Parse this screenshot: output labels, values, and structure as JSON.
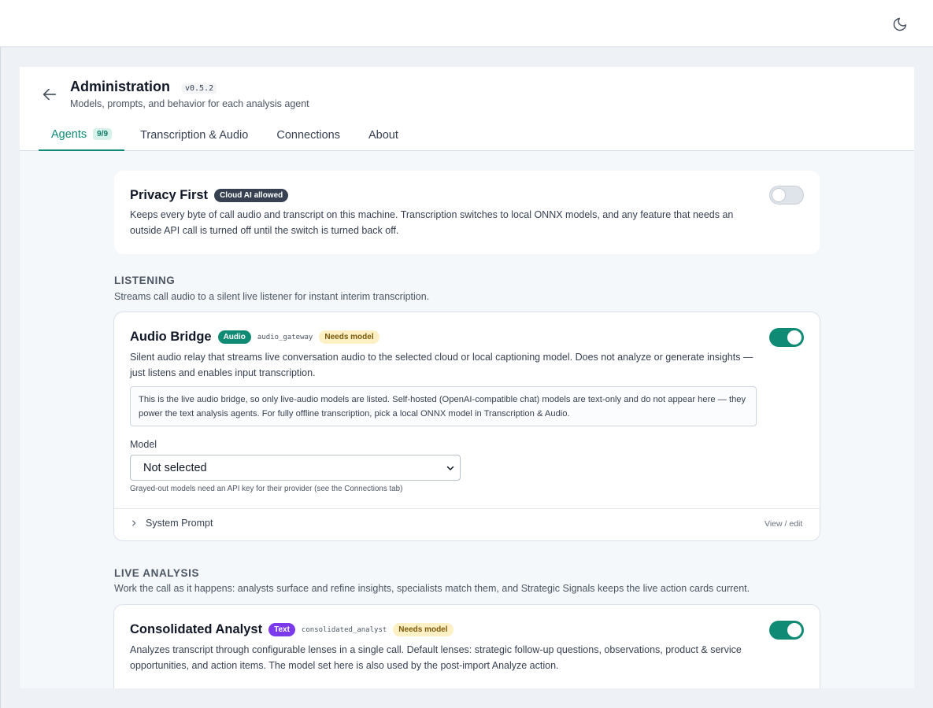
{
  "topbar": {
    "theme_icon": "moon-icon"
  },
  "header": {
    "title": "Administration",
    "version": "v0.5.2",
    "subtitle": "Models, prompts, and behavior for each analysis agent"
  },
  "tabs": [
    {
      "label": "Agents",
      "count": "9/9",
      "active": true
    },
    {
      "label": "Transcription & Audio"
    },
    {
      "label": "Connections"
    },
    {
      "label": "About"
    }
  ],
  "privacy": {
    "title": "Privacy First",
    "badge": "Cloud AI allowed",
    "description": "Keeps every byte of call audio and transcript on this machine. Transcription switches to local ONNX models, and any feature that needs an outside API call is turned off until the switch is turned back off.",
    "enabled": false
  },
  "sections": {
    "listening": {
      "label": "LISTENING",
      "description": "Streams call audio to a silent live listener for instant interim transcription."
    },
    "live_analysis": {
      "label": "LIVE ANALYSIS",
      "description": "Work the call as it happens: analysts surface and refine insights, specialists match them, and Strategic Signals keeps the live action cards current."
    }
  },
  "agents": {
    "audio_bridge": {
      "title": "Audio Bridge",
      "type_badge": "Audio",
      "id": "audio_gateway",
      "status_badge": "Needs model",
      "description": "Silent audio relay that streams live conversation audio to the selected cloud or local captioning model. Does not analyze or generate insights — just listens and enables input transcription.",
      "note": "This is the live audio bridge, so only live-audio models are listed. Self-hosted (OpenAI-compatible chat) models are text-only and do not appear here — they power the text analysis agents. For fully offline transcription, pick a local ONNX model in Transcription & Audio.",
      "model_label": "Model",
      "model_value": "Not selected",
      "model_hint": "Grayed-out models need an API key for their provider (see the Connections tab)",
      "system_prompt_label": "System Prompt",
      "view_edit": "View / edit",
      "enabled": true
    },
    "consolidated_analyst": {
      "title": "Consolidated Analyst",
      "type_badge": "Text",
      "id": "consolidated_analyst",
      "status_badge": "Needs model",
      "description": "Analyzes transcript through configurable lenses in a single call. Default lenses: strategic follow-up questions, observations, product & service opportunities, and action items. The model set here is also used by the post-import Analyze action.",
      "enabled": true
    }
  },
  "colors": {
    "accent": "#0f8a74",
    "text_badge": "#7c3aed",
    "warning_badge": "#fdf0c4"
  }
}
